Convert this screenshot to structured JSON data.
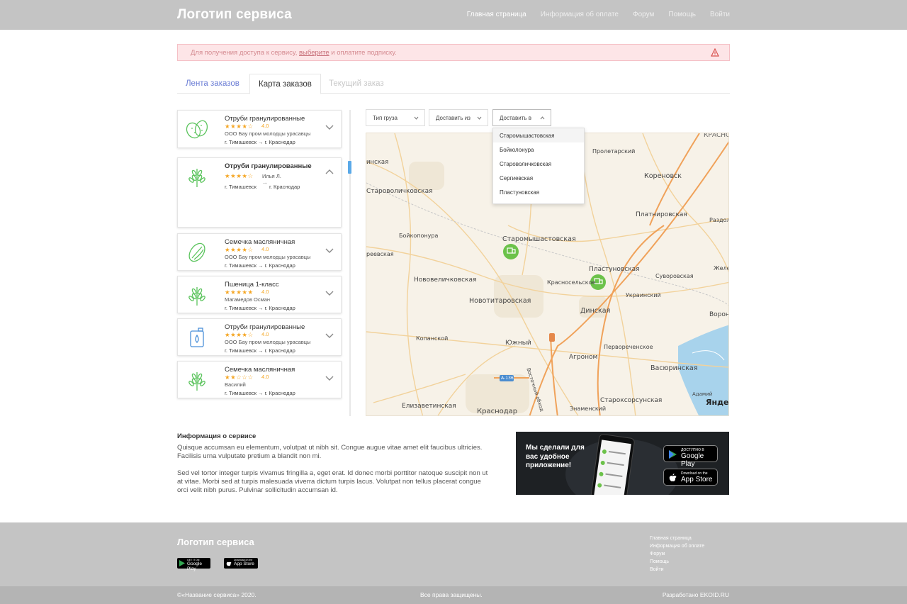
{
  "header": {
    "logo": "Логотип сервиса",
    "nav": [
      "Главная страница",
      "Информация об оплате",
      "Форум",
      "Помощь",
      "Войти"
    ]
  },
  "alert": {
    "before": "Для получения доступа к сервису, ",
    "link": "выберите",
    "after": " и оплатите подписку."
  },
  "tabs": [
    "Лента заказов",
    "Карта заказов",
    "Текущий заказ"
  ],
  "orders": [
    {
      "title": "Отруби гранулированные",
      "stars": "★★★★☆",
      "rating": "4.0",
      "company": "ООО Бау пром молодцы урасавцы",
      "route": "г. Тимашевск → г. Краснодар",
      "icon": "potato-icon"
    },
    {
      "title": "Отруби гранулированные",
      "stars": "★★★★☆",
      "rating": "",
      "company": "Илья Л.",
      "route_from": "г. Тимашевск",
      "route_arrow": "→",
      "route_to": "г. Краснодар",
      "icon": "wheat-icon",
      "expanded": true
    },
    {
      "title": "Семечка масляничная",
      "stars": "★★★★☆",
      "rating": "4.0",
      "company": "ООО Бау пром молодцы урасавцы",
      "route": "г. Тимашевск → г. Краснодар",
      "icon": "seed-icon"
    },
    {
      "title": "Пшеница 1-класс",
      "stars": "★★★★★",
      "rating": "4.0",
      "company": "Магамедов  Осман",
      "route": "г. Тимашевск → г. Краснодар",
      "icon": "wheat-icon"
    },
    {
      "title": "Отруби гранулированные",
      "stars": "★★★★☆",
      "rating": "4.0",
      "company": "ООО Бау пром молодцы урасавцы",
      "route": "г. Тимашевск → г. Краснодар",
      "icon": "oil-can-icon"
    },
    {
      "title": "Семечка масляничная",
      "stars": "★★☆☆☆",
      "rating": "4.0",
      "company": "Василий",
      "route": "г. Тимашевск → г. Краснодар",
      "icon": "wheat-icon"
    }
  ],
  "filters": {
    "cargo_type": "Тип груза",
    "deliver_from": "Доставить из",
    "deliver_to": "Доставить в"
  },
  "dropdown": [
    "Старомышастовская",
    "Бойколонура",
    "Староволичковская",
    "Сергиевская",
    "Пластуновская"
  ],
  "map": {
    "labels": [
      "КРАСНО",
      "Пролетарский",
      "Кореновск",
      "инская",
      "Староволичковская",
      "Платнировская",
      "Раздол",
      "Бойкопонура",
      "Старомышастовская",
      "реевская",
      "Пластуновская",
      "Суворовская",
      "Желе",
      "Нововеличковская",
      "Красносельское",
      "Украинский",
      "Новотитаровская",
      "Динская",
      "Воронс",
      "Копанской",
      "Южный",
      "Первореченское",
      "Агроном",
      "Васюринская",
      "Восточный обход",
      "А-136",
      "Адамий",
      "Елизаветинская",
      "Краснодар",
      "Староксорсунская",
      "Знаменский",
      "Яндекс"
    ],
    "colors": {
      "bg": "#f7f2e8",
      "road_major": "#f0a25a",
      "road_minor": "#f2d29b",
      "marker": "#6cc24a",
      "water": "#a8d3ec"
    }
  },
  "info": {
    "heading": "Информация о сервисе",
    "p1": "Quisque accumsan eu elementum, volutpat ut nibh sit. Congue augue vitae amet elit faucibus ultricies. Facilisis urna vulputate pretium a blandit non mi.",
    "p2": "Sed vel tortor integer turpis vivamus fringilla a, eget erat. Id donec morbi porttitor natoque suscipit non ut at vitae. Morbi sed at turpis malesuada viverra dictum turpis lacus. Volutpat non tellus placerat congue orci velit nibh purus. Pulvinar sollicitudin accumsan id."
  },
  "promo": {
    "text": "Мы сделали для вас удобное приложение!",
    "google_small": "ДОСТУПНО В",
    "google_large": "Google Play",
    "apple_small": "Download on the",
    "apple_large": "App Store"
  },
  "footer": {
    "logo": "Логотип сервиса",
    "google_small": "GET IT ON",
    "google_large": "Google Play",
    "apple_small": "Download on the",
    "apple_large": "App Store",
    "links": [
      "Главная страница",
      "Информация об оплате",
      "Форум",
      "Помощь",
      "Войти"
    ],
    "copyright": "©«Название сервиса» 2020.",
    "rights": "Все права защищены.",
    "developer": "Разработано EKOID.RU"
  }
}
